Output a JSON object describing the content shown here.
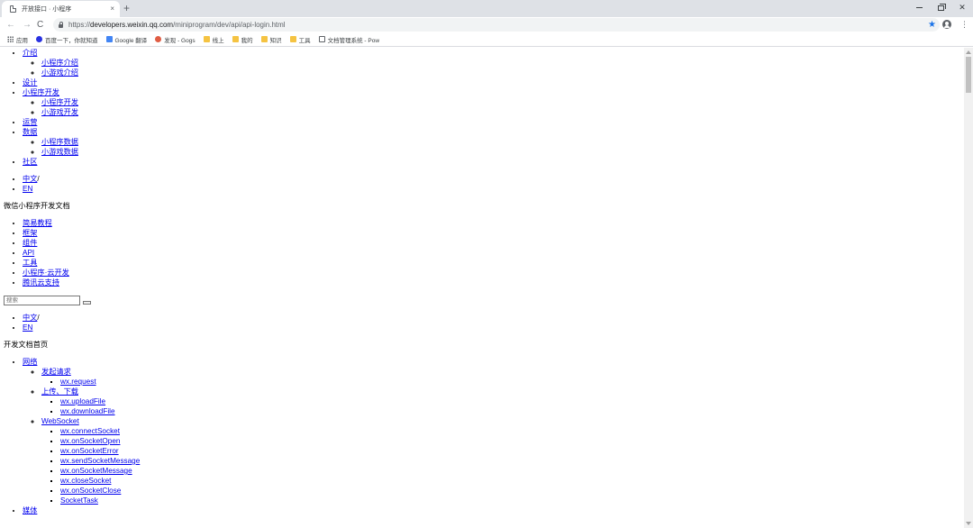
{
  "browser": {
    "tab_title": "开放接口 · 小程序",
    "tab_close": "×",
    "new_tab": "+",
    "url_scheme": "https://",
    "url_host": "developers.weixin.qq.com",
    "url_path": "/miniprogram/dev/api/api-login.html",
    "back": "←",
    "forward": "→",
    "reload": "C",
    "star": "★",
    "menu": "⋮",
    "close_window": "✕"
  },
  "bookmarks": [
    {
      "label": "应用",
      "icon": "apps-icon",
      "cls": "apps"
    },
    {
      "label": "百度一下，你就知道",
      "icon": "baidu-icon",
      "cls": "baidu"
    },
    {
      "label": "Google 翻译",
      "icon": "google-translate-icon",
      "cls": "gtrans"
    },
    {
      "label": "发现 - Gogs",
      "icon": "gogs-icon",
      "cls": "gogs"
    },
    {
      "label": "线上",
      "icon": "folder-icon",
      "cls": "folder"
    },
    {
      "label": "我的",
      "icon": "folder-icon",
      "cls": "folder"
    },
    {
      "label": "知识",
      "icon": "folder-icon",
      "cls": "folder"
    },
    {
      "label": "工具",
      "icon": "folder-icon",
      "cls": "folder"
    },
    {
      "label": "文档管理系统 - Pow",
      "icon": "document-icon",
      "cls": "doc"
    }
  ],
  "top_nav": {
    "intro": "介绍",
    "intro_mini_program": "小程序介绍",
    "intro_mini_game": "小游戏介绍",
    "design": "设计",
    "dev": "小程序开发",
    "dev_mini_program": "小程序开发",
    "dev_mini_game": "小游戏开发",
    "operation": "运营",
    "data": "数据",
    "data_mini_program": "小程序数据",
    "data_mini_game": "小游戏数据",
    "community": "社区"
  },
  "lang1": {
    "zh": "中文",
    "sep": "/",
    "en": "EN"
  },
  "doc_title": "微信小程序开发文档",
  "doc_nav": {
    "tutorial": "简易教程",
    "framework": "框架",
    "components": "组件",
    "api": "API",
    "tools": "工具",
    "cloud": "小程序·云开发",
    "tencent_cloud": "腾讯云支持"
  },
  "search": {
    "placeholder": "搜索"
  },
  "lang2": {
    "zh": "中文",
    "sep": "/",
    "en": "EN"
  },
  "home_title": "开发文档首页",
  "api_tree": {
    "network": "网络",
    "request_group": "发起请求",
    "wx_request": "wx.request",
    "upload_download": "上传、下载",
    "wx_uploadFile": "wx.uploadFile",
    "wx_downloadFile": "wx.downloadFile",
    "websocket": "WebSocket",
    "wx_connectSocket": "wx.connectSocket",
    "wx_onSocketOpen": "wx.onSocketOpen",
    "wx_onSocketError": "wx.onSocketError",
    "wx_sendSocketMessage": "wx.sendSocketMessage",
    "wx_onSocketMessage": "wx.onSocketMessage",
    "wx_closeSocket": "wx.closeSocket",
    "wx_onSocketClose": "wx.onSocketClose",
    "socket_task": "SocketTask",
    "media": "媒体"
  }
}
